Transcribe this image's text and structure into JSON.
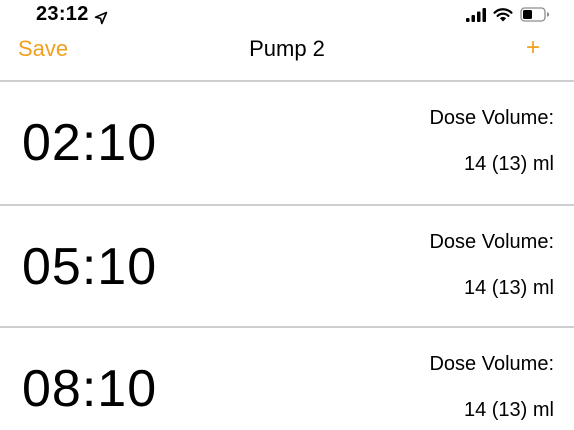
{
  "status_bar": {
    "time": "23:12",
    "location_icon": "location-arrow-icon",
    "signal_icon": "cellular-signal-icon",
    "wifi_icon": "wifi-icon",
    "battery_icon": "battery-icon"
  },
  "nav": {
    "save_label": "Save",
    "title": "Pump 2",
    "add_label": "+",
    "accent_color": "#f0a020"
  },
  "schedule": [
    {
      "time": "02:10",
      "dose_label": "Dose Volume:",
      "dose_value": "14 (13) ml"
    },
    {
      "time": "05:10",
      "dose_label": "Dose Volume:",
      "dose_value": "14 (13) ml"
    },
    {
      "time": "08:10",
      "dose_label": "Dose Volume:",
      "dose_value": "14 (13) ml"
    }
  ]
}
